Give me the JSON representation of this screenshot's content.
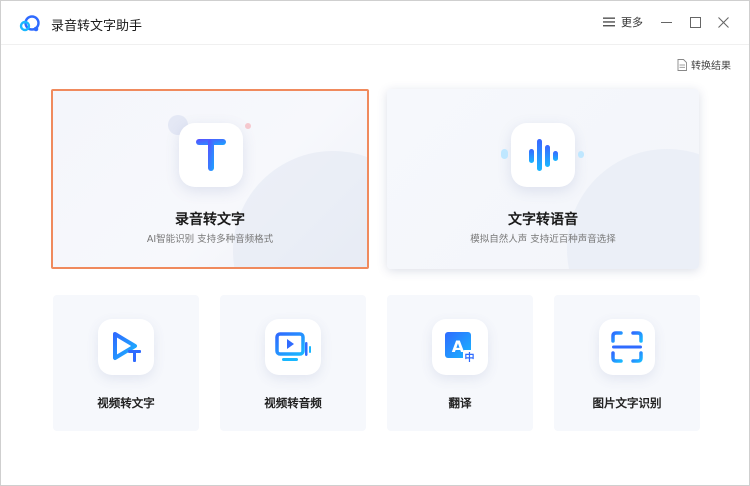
{
  "app": {
    "title": "录音转文字助手"
  },
  "titlebar": {
    "more_label": "更多",
    "minimize": "minimize",
    "maximize": "maximize",
    "close": "close"
  },
  "toolbar": {
    "result_label": "转换结果"
  },
  "features": {
    "record_to_text": {
      "title": "录音转文字",
      "subtitle": "AI智能识别 支持多种音频格式"
    },
    "text_to_speech": {
      "title": "文字转语音",
      "subtitle": "模拟自然人声 支持近百种声音选择"
    },
    "video_to_text": {
      "title": "视频转文字"
    },
    "video_to_audio": {
      "title": "视频转音频"
    },
    "translate": {
      "title": "翻译"
    },
    "image_ocr": {
      "title": "图片文字识别"
    }
  },
  "icons": {
    "logo": "cloud-logo-icon",
    "more": "menu-icon",
    "result": "document-icon",
    "record": "text-t-icon",
    "tts": "waveform-icon",
    "video_text": "play-text-icon",
    "video_audio": "video-audio-icon",
    "translate": "translate-icon",
    "ocr": "scan-icon"
  },
  "colors": {
    "accent_blue": "#2f6bff",
    "accent_cyan": "#19b7ff",
    "selected_border": "#f08a5d"
  }
}
